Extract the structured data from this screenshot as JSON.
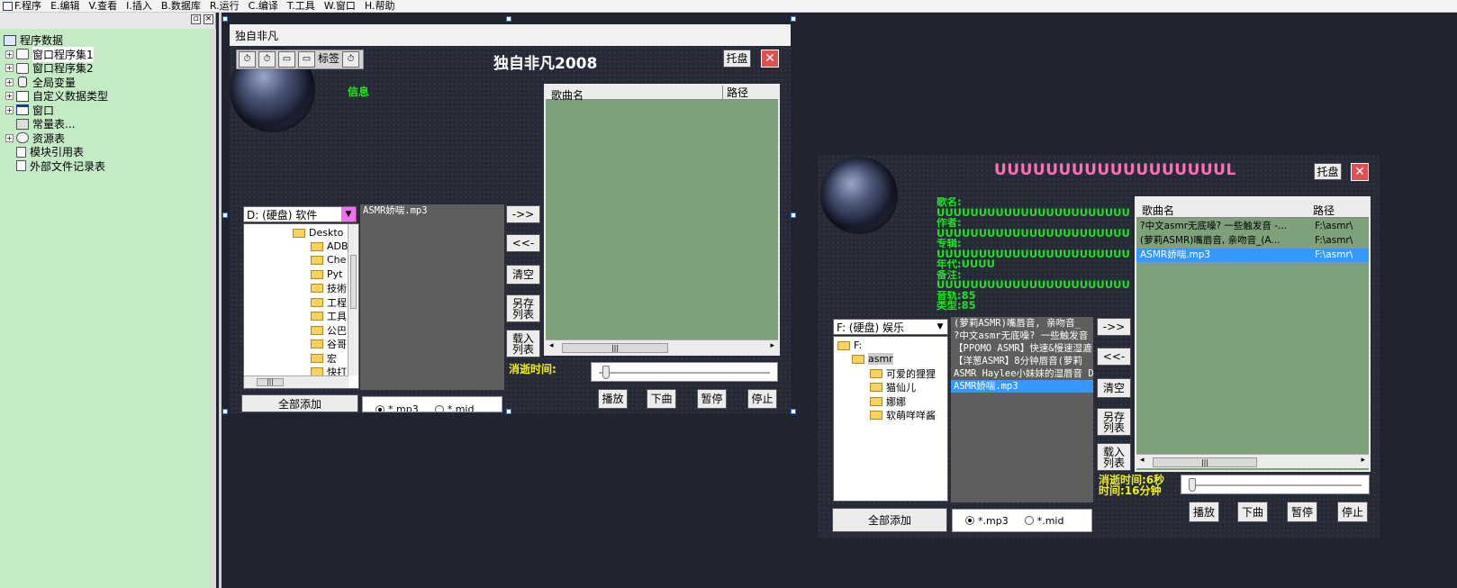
{
  "menubar": {
    "items": [
      "F.程序",
      "E.编辑",
      "V.查看",
      "I.插入",
      "B.数据库",
      "R.运行",
      "C.编译",
      "T.工具",
      "W.窗口",
      "H.帮助"
    ]
  },
  "tree_header": {
    "pin": "▫",
    "close": "×"
  },
  "tree": {
    "items": [
      {
        "label": "程序数据",
        "expander": ""
      },
      {
        "label": "窗口程序集1",
        "expander": "+"
      },
      {
        "label": "窗口程序集2",
        "expander": "+"
      },
      {
        "label": "全局变量",
        "expander": "+"
      },
      {
        "label": "自定义数据类型",
        "expander": "+"
      },
      {
        "label": "窗口",
        "expander": "+"
      },
      {
        "label": "常量表...",
        "expander": ""
      },
      {
        "label": "资源表",
        "expander": "+"
      },
      {
        "label": "模块引用表",
        "expander": ""
      },
      {
        "label": "外部文件记录表",
        "expander": ""
      }
    ]
  },
  "design_form": {
    "caption": "独自非凡",
    "toolbar_label": "标签",
    "title": "独自非凡2008",
    "tray_button": "托盘",
    "close_button": "✕",
    "info_label": "信息",
    "list_headers": {
      "name": "歌曲名",
      "path": "路径"
    },
    "drive_combo": "D: (硬盘) 软件",
    "dirs": [
      "Deskto",
      "ADB",
      "Che",
      "Pyt",
      "技術",
      "工程",
      "工具",
      "公巴",
      "谷哥",
      "宏",
      "快打"
    ],
    "files": [
      "ASMR娇喘.mp3"
    ],
    "buttons": {
      "add": "->>",
      "remove": "<<-",
      "clear": "清空",
      "save": "另存\n列表",
      "load": "载入\n列表"
    },
    "elapsed_label": "消逝时间:",
    "controls": {
      "play": "播放",
      "next": "下曲",
      "pause": "暂停",
      "stop": "停止"
    },
    "add_all": "全部添加",
    "radio": {
      "mp3": "*.mp3",
      "mid": "*.mid"
    },
    "scroll_thumb": "|||"
  },
  "run_form": {
    "title": "UUUUUUUUUUUUUUUUUUL",
    "tray_button": "托盘",
    "close_button": "✕",
    "info_lines": [
      "歌名:",
      "UUUUUUUUUUUUUUUUUUUUUUUUUUUUUUUU",
      "作者:",
      "UUUUUUUUUUUUUUUUUUUUUUUUUUUUUUUU",
      "专辑:",
      "UUUUUUUUUUUUUUUUUUUUUUUUUUUUUUUU",
      "年代:UUUU",
      "备注:",
      "UUUUUUUUUUUUUUUUUUUUUUUUUUUUUU",
      "音轨:85",
      "类型:85"
    ],
    "list_headers": {
      "name": "歌曲名",
      "path": "路径"
    },
    "playlist": [
      {
        "name": "?中文asmr无底噪? 一些触发音 -...",
        "path": "F:\\asmr\\"
      },
      {
        "name": "(萝莉ASMR)嘴唇音, 亲吻音_(A...",
        "path": "F:\\asmr\\"
      },
      {
        "name": "ASMR娇喘.mp3",
        "path": "F:\\asmr\\"
      }
    ],
    "drive_combo": "F: (硬盘) 娱乐",
    "dirs": [
      "F:",
      "asmr",
      "可爱的狸狸",
      "猫仙儿",
      "娜娜",
      "软萌咩咩酱"
    ],
    "files": [
      "(萝莉ASMR)嘴唇音, 亲吻音_",
      "?中文asmr无底噪? 一些触发音",
      "【PPOMO ASMR】快速&慢速湿漉",
      "【洋葱ASMR】8分钟唇音(萝莉",
      "ASMR Haylee小妹妹的湿唇音 D",
      "ASMR娇喘.mp3"
    ],
    "buttons": {
      "add": "->>",
      "remove": "<<-",
      "clear": "清空",
      "save": "另存\n列表",
      "load": "载入\n列表"
    },
    "elapsed": "消逝时间:6秒",
    "duration": "时间:16分钟",
    "controls": {
      "play": "播放",
      "next": "下曲",
      "pause": "暂停",
      "stop": "停止"
    },
    "add_all": "全部添加",
    "radio": {
      "mp3": "*.mp3",
      "mid": "*.mid"
    },
    "scroll_thumb": "|||",
    "slider_position": 0.0
  },
  "colors": {
    "skin": "#262a37",
    "listview": "#7ea07a",
    "tree_bg": "#c4ebc6",
    "info_green": "#1fe31f",
    "time_yellow": "#f0f01c",
    "title_pink": "#ff6fb2",
    "selection": "#3399ff"
  }
}
